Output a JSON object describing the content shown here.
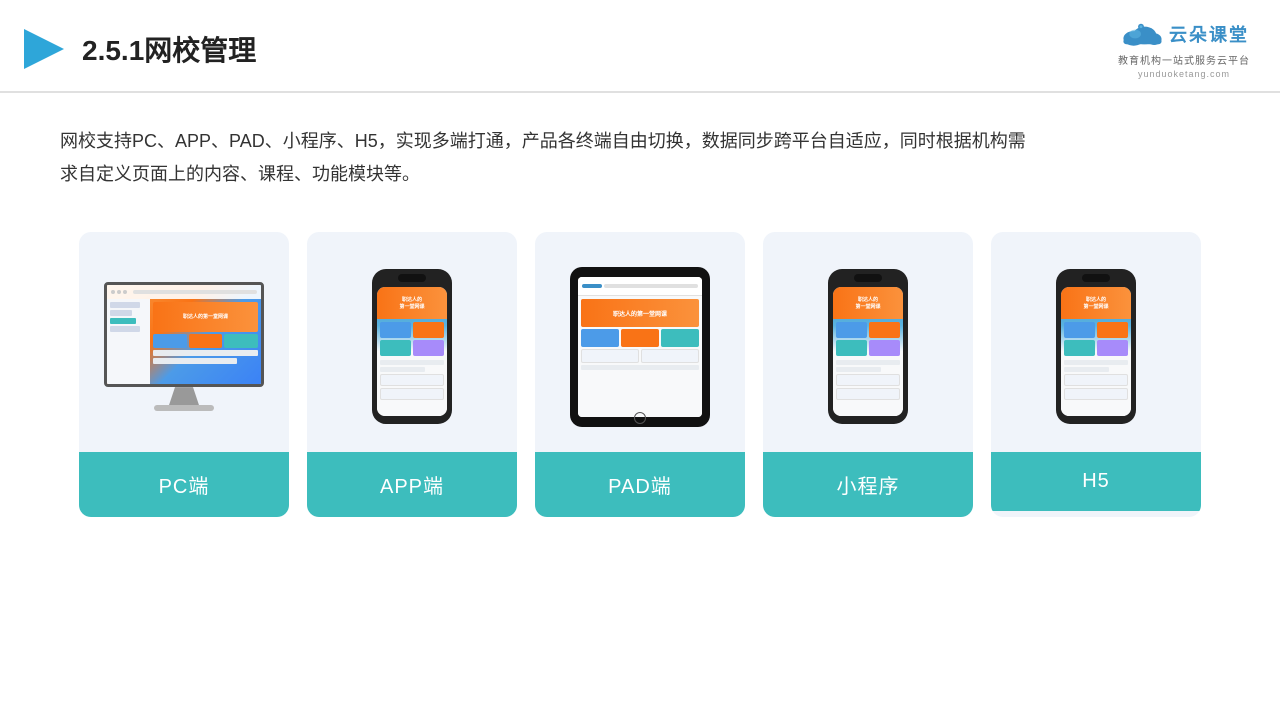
{
  "header": {
    "title": "2.5.1网校管理",
    "logo_text": "云朵课堂",
    "logo_sub": "教育机构一站式服务云平台",
    "logo_url": "yunduoketang.com"
  },
  "description": {
    "text": "网校支持PC、APP、PAD、小程序、H5，实现多端打通，产品各终端自由切换，数据同步跨平台自适应，同时根据机构需求自定义页面上的内容、课程、功能模块等。"
  },
  "cards": [
    {
      "id": "pc",
      "label": "PC端"
    },
    {
      "id": "app",
      "label": "APP端"
    },
    {
      "id": "pad",
      "label": "PAD端"
    },
    {
      "id": "miniapp",
      "label": "小程序"
    },
    {
      "id": "h5",
      "label": "H5"
    }
  ],
  "colors": {
    "accent": "#3dbdbd",
    "header_border": "#e0e0e0",
    "card_bg": "#f0f4fa",
    "logo_color": "#3a8fc7"
  }
}
